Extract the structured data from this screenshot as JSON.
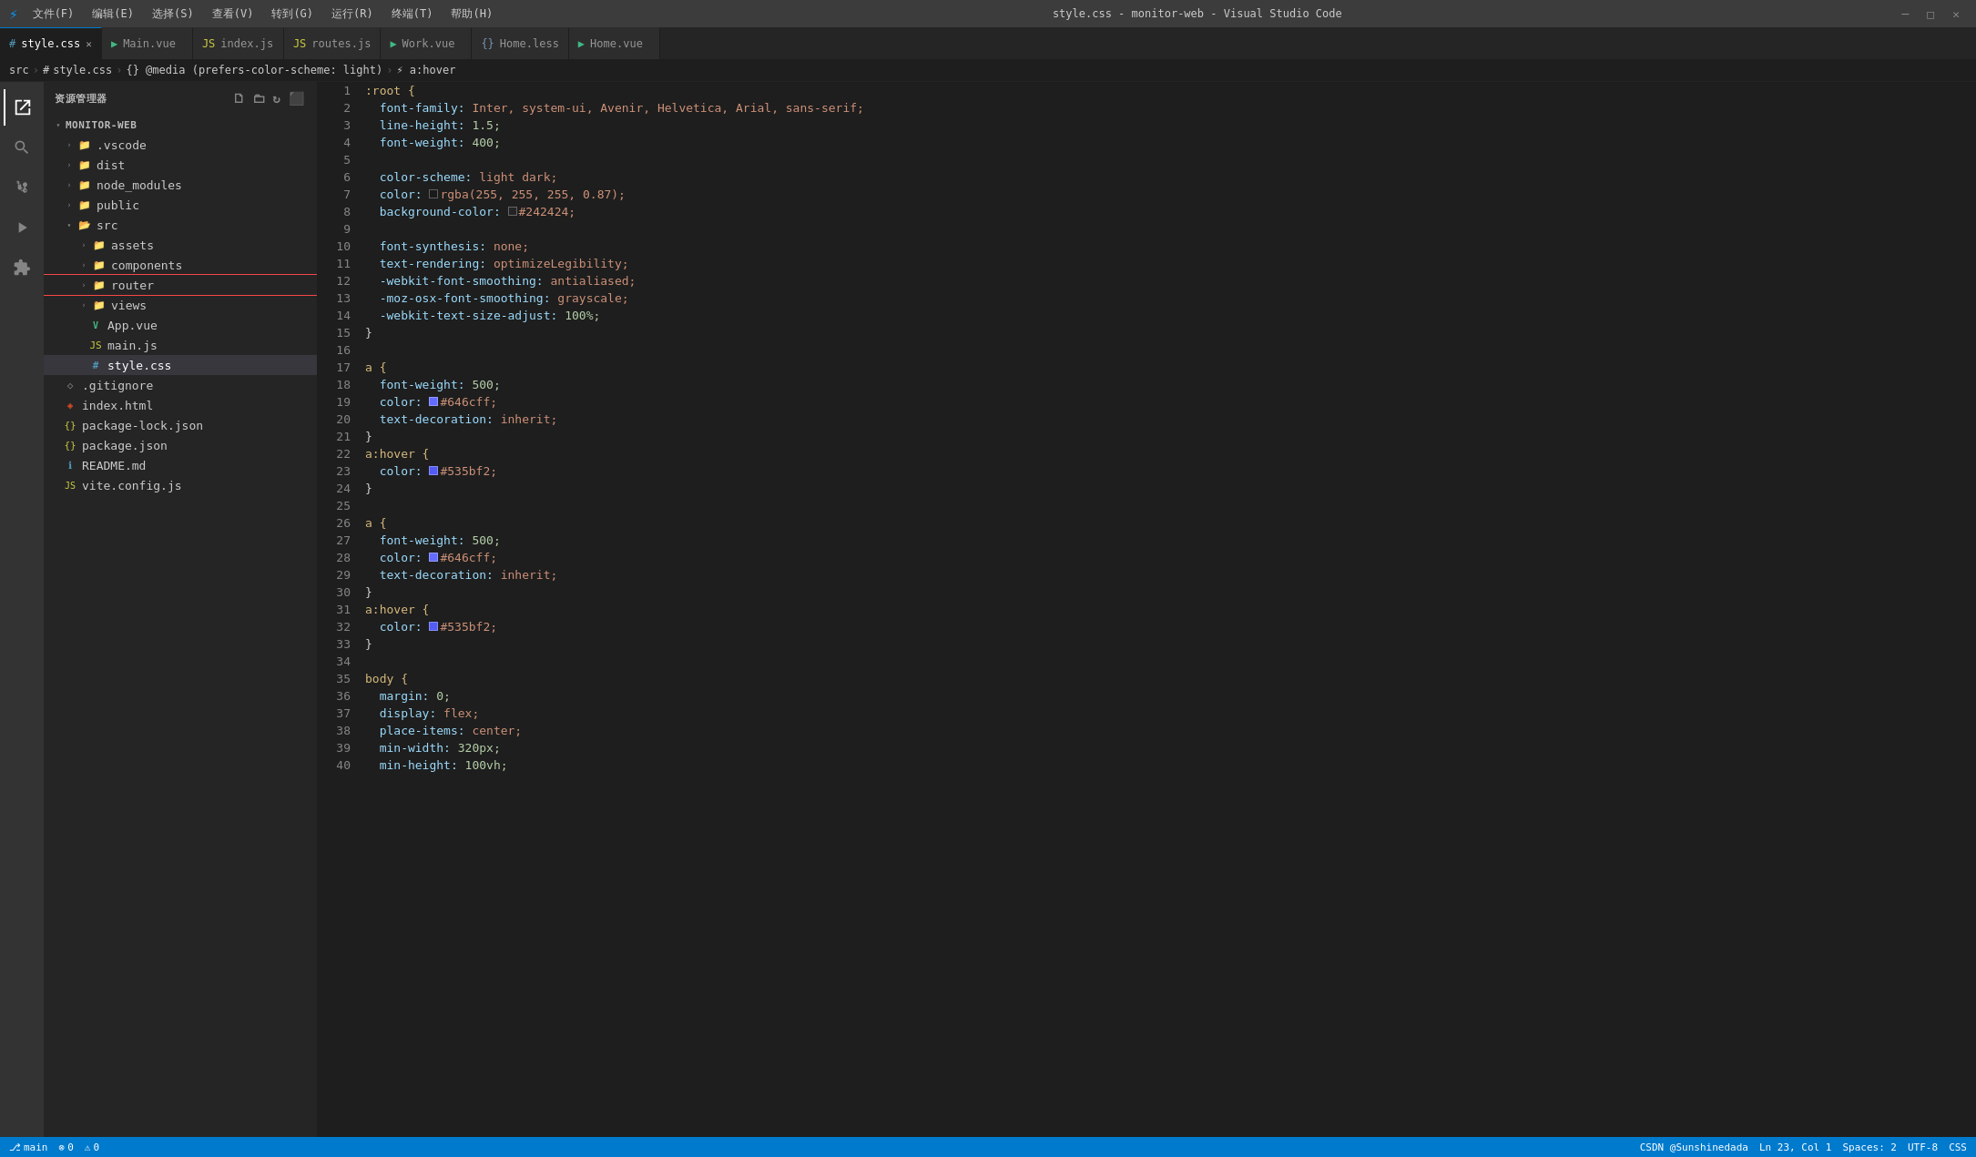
{
  "titleBar": {
    "logo": "VS",
    "title": "style.css - monitor-web - Visual Studio Code",
    "menus": [
      "文件(F)",
      "编辑(E)",
      "选择(S)",
      "查看(V)",
      "转到(G)",
      "运行(R)",
      "终端(T)",
      "帮助(H)"
    ]
  },
  "tabs": [
    {
      "id": "style.css",
      "label": "style.css",
      "type": "css",
      "active": true,
      "icon": "#"
    },
    {
      "id": "Main.vue",
      "label": "Main.vue",
      "type": "vue",
      "active": false,
      "icon": "V"
    },
    {
      "id": "index.js",
      "label": "index.js",
      "type": "js",
      "active": false,
      "icon": "JS"
    },
    {
      "id": "routes.js",
      "label": "routes.js",
      "type": "js",
      "active": false,
      "icon": "JS"
    },
    {
      "id": "Work.vue",
      "label": "Work.vue",
      "type": "vue",
      "active": false,
      "icon": "V"
    },
    {
      "id": "Home.less",
      "label": "Home.less",
      "type": "less",
      "active": false,
      "icon": "{}"
    },
    {
      "id": "Home.vue",
      "label": "Home.vue",
      "type": "vue",
      "active": false,
      "icon": "V"
    }
  ],
  "breadcrumb": {
    "items": [
      "src",
      "#",
      "style.css",
      "{}",
      "@media (prefers-color-scheme: light)",
      ">",
      "a:hover"
    ]
  },
  "sidebar": {
    "title": "资源管理器",
    "rootName": "MONITOR-WEB",
    "tree": [
      {
        "id": "vscode",
        "label": ".vscode",
        "type": "folder",
        "depth": 1,
        "collapsed": true
      },
      {
        "id": "dist",
        "label": "dist",
        "type": "folder",
        "depth": 1,
        "collapsed": true
      },
      {
        "id": "node_modules",
        "label": "node_modules",
        "type": "folder",
        "depth": 1,
        "collapsed": true
      },
      {
        "id": "public",
        "label": "public",
        "type": "folder",
        "depth": 1,
        "collapsed": true
      },
      {
        "id": "src",
        "label": "src",
        "type": "folder",
        "depth": 1,
        "collapsed": false
      },
      {
        "id": "assets",
        "label": "assets",
        "type": "folder",
        "depth": 2,
        "collapsed": true
      },
      {
        "id": "components",
        "label": "components",
        "type": "folder",
        "depth": 2,
        "collapsed": true
      },
      {
        "id": "router",
        "label": "router",
        "type": "folder",
        "depth": 2,
        "collapsed": true
      },
      {
        "id": "views",
        "label": "views",
        "type": "folder",
        "depth": 2,
        "collapsed": true
      },
      {
        "id": "App.vue",
        "label": "App.vue",
        "type": "vue",
        "depth": 2
      },
      {
        "id": "main.js",
        "label": "main.js",
        "type": "js",
        "depth": 2
      },
      {
        "id": "style.css",
        "label": "style.css",
        "type": "css",
        "depth": 2,
        "active": true
      },
      {
        "id": ".gitignore",
        "label": ".gitignore",
        "type": "git",
        "depth": 1
      },
      {
        "id": "index.html",
        "label": "index.html",
        "type": "html",
        "depth": 1
      },
      {
        "id": "package-lock.json",
        "label": "package-lock.json",
        "type": "json",
        "depth": 1
      },
      {
        "id": "package.json",
        "label": "package.json",
        "type": "json",
        "depth": 1
      },
      {
        "id": "README.md",
        "label": "README.md",
        "type": "md",
        "depth": 1
      },
      {
        "id": "vite.config.js",
        "label": "vite.config.js",
        "type": "js",
        "depth": 1
      }
    ]
  },
  "editor": {
    "lines": [
      {
        "num": 1,
        "tokens": [
          {
            "t": ":root {",
            "c": "s-selector"
          }
        ]
      },
      {
        "num": 2,
        "tokens": [
          {
            "t": "  font-family: ",
            "c": "s-property"
          },
          {
            "t": "Inter, system-ui, Avenir, Helvetica, Arial, sans-serif;",
            "c": "s-value"
          }
        ]
      },
      {
        "num": 3,
        "tokens": [
          {
            "t": "  line-height: ",
            "c": "s-property"
          },
          {
            "t": "1.5;",
            "c": "s-value-num"
          }
        ]
      },
      {
        "num": 4,
        "tokens": [
          {
            "t": "  font-weight: ",
            "c": "s-property"
          },
          {
            "t": "400;",
            "c": "s-value-num"
          }
        ]
      },
      {
        "num": 5,
        "tokens": []
      },
      {
        "num": 6,
        "tokens": [
          {
            "t": "  color-scheme: ",
            "c": "s-property"
          },
          {
            "t": "light dark;",
            "c": "s-value-kw"
          }
        ]
      },
      {
        "num": 7,
        "tokens": [
          {
            "t": "  color: ",
            "c": "s-property"
          },
          {
            "t": "color-box:#1a1a1a",
            "c": "color-box"
          },
          {
            "t": "rgba(255, 255, 255, 0.87);",
            "c": "s-value"
          }
        ]
      },
      {
        "num": 8,
        "tokens": [
          {
            "t": "  background-color: ",
            "c": "s-property"
          },
          {
            "t": "color-box:#242424",
            "c": "color-box"
          },
          {
            "t": "#242424;",
            "c": "s-value-color"
          }
        ]
      },
      {
        "num": 9,
        "tokens": []
      },
      {
        "num": 10,
        "tokens": [
          {
            "t": "  font-synthesis: ",
            "c": "s-property"
          },
          {
            "t": "none;",
            "c": "s-value-kw"
          }
        ]
      },
      {
        "num": 11,
        "tokens": [
          {
            "t": "  text-rendering: ",
            "c": "s-property"
          },
          {
            "t": "optimizeLegibility;",
            "c": "s-value"
          }
        ]
      },
      {
        "num": 12,
        "tokens": [
          {
            "t": "  -webkit-font-smoothing: ",
            "c": "s-property"
          },
          {
            "t": "antialiased;",
            "c": "s-value"
          }
        ]
      },
      {
        "num": 13,
        "tokens": [
          {
            "t": "  -moz-osx-font-smoothing: ",
            "c": "s-property"
          },
          {
            "t": "grayscale;",
            "c": "s-value"
          }
        ]
      },
      {
        "num": 14,
        "tokens": [
          {
            "t": "  -webkit-text-size-adjust: ",
            "c": "s-property"
          },
          {
            "t": "100%;",
            "c": "s-value-num"
          }
        ]
      },
      {
        "num": 15,
        "tokens": [
          {
            "t": "}",
            "c": "s-brace"
          }
        ]
      },
      {
        "num": 16,
        "tokens": []
      },
      {
        "num": 17,
        "tokens": [
          {
            "t": "a {",
            "c": "s-selector"
          }
        ]
      },
      {
        "num": 18,
        "tokens": [
          {
            "t": "  font-weight: ",
            "c": "s-property"
          },
          {
            "t": "500;",
            "c": "s-value-num"
          }
        ]
      },
      {
        "num": 19,
        "tokens": [
          {
            "t": "  color: ",
            "c": "s-property"
          },
          {
            "t": "color-box:#646cff",
            "c": "color-box"
          },
          {
            "t": "#646cff;",
            "c": "s-value-color"
          }
        ]
      },
      {
        "num": 20,
        "tokens": [
          {
            "t": "  text-decoration: ",
            "c": "s-property"
          },
          {
            "t": "inherit;",
            "c": "s-value-kw"
          }
        ]
      },
      {
        "num": 21,
        "tokens": [
          {
            "t": "}",
            "c": "s-brace"
          }
        ]
      },
      {
        "num": 22,
        "tokens": [
          {
            "t": "a:hover {",
            "c": "s-selector"
          }
        ]
      },
      {
        "num": 23,
        "tokens": [
          {
            "t": "  color: ",
            "c": "s-property"
          },
          {
            "t": "color-box:#535bf2",
            "c": "color-box"
          },
          {
            "t": "#535bf2;",
            "c": "s-value-color"
          }
        ]
      },
      {
        "num": 24,
        "tokens": [
          {
            "t": "}",
            "c": "s-brace"
          }
        ]
      },
      {
        "num": 25,
        "tokens": []
      },
      {
        "num": 26,
        "tokens": [
          {
            "t": "a {",
            "c": "s-selector"
          }
        ]
      },
      {
        "num": 27,
        "tokens": [
          {
            "t": "  font-weight: ",
            "c": "s-property"
          },
          {
            "t": "500;",
            "c": "s-value-num"
          }
        ]
      },
      {
        "num": 28,
        "tokens": [
          {
            "t": "  color: ",
            "c": "s-property"
          },
          {
            "t": "color-box:#646cff",
            "c": "color-box"
          },
          {
            "t": "#646cff;",
            "c": "s-value-color"
          }
        ]
      },
      {
        "num": 29,
        "tokens": [
          {
            "t": "  text-decoration: ",
            "c": "s-property"
          },
          {
            "t": "inherit;",
            "c": "s-value-kw"
          }
        ]
      },
      {
        "num": 30,
        "tokens": [
          {
            "t": "}",
            "c": "s-brace"
          }
        ]
      },
      {
        "num": 31,
        "tokens": [
          {
            "t": "a:hover {",
            "c": "s-selector"
          }
        ]
      },
      {
        "num": 32,
        "tokens": [
          {
            "t": "  color: ",
            "c": "s-property"
          },
          {
            "t": "color-box:#535bf2",
            "c": "color-box"
          },
          {
            "t": "#535bf2;",
            "c": "s-value-color"
          }
        ]
      },
      {
        "num": 33,
        "tokens": [
          {
            "t": "}",
            "c": "s-brace"
          }
        ]
      },
      {
        "num": 34,
        "tokens": []
      },
      {
        "num": 35,
        "tokens": [
          {
            "t": "body {",
            "c": "s-selector"
          }
        ]
      },
      {
        "num": 36,
        "tokens": [
          {
            "t": "  margin: ",
            "c": "s-property"
          },
          {
            "t": "0;",
            "c": "s-value-num"
          }
        ]
      },
      {
        "num": 37,
        "tokens": [
          {
            "t": "  display: ",
            "c": "s-property"
          },
          {
            "t": "flex;",
            "c": "s-value-kw"
          }
        ]
      },
      {
        "num": 38,
        "tokens": [
          {
            "t": "  place-items: ",
            "c": "s-property"
          },
          {
            "t": "center;",
            "c": "s-value-kw"
          }
        ]
      },
      {
        "num": 39,
        "tokens": [
          {
            "t": "  min-width: ",
            "c": "s-property"
          },
          {
            "t": "320px;",
            "c": "s-value-num"
          }
        ]
      },
      {
        "num": 40,
        "tokens": [
          {
            "t": "  min-height: ",
            "c": "s-property"
          },
          {
            "t": "100vh;",
            "c": "s-value-num"
          }
        ]
      }
    ]
  },
  "statusBar": {
    "left": [
      "⎇ main",
      "⚠ 0",
      "⊗ 0"
    ],
    "right": [
      "CSDN @Sunshinedada",
      "Ln 23, Col 1",
      "Spaces: 2",
      "UTF-8",
      "CSS"
    ]
  },
  "colors": {
    "accent": "#007acc",
    "brand_vue": "#41b883",
    "error_red": "#f44747"
  }
}
